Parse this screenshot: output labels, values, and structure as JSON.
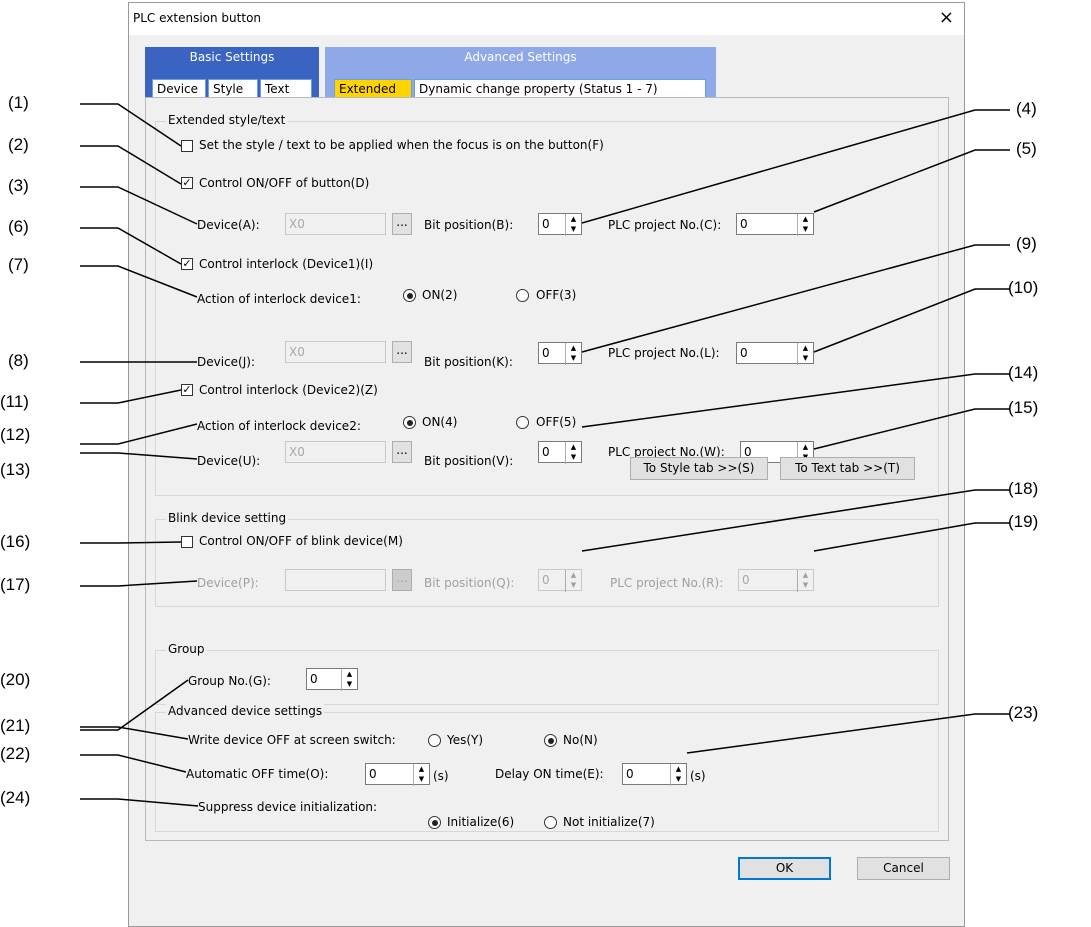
{
  "window": {
    "title": "PLC extension button",
    "close": "×"
  },
  "tabs": {
    "basic_group": "Basic Settings",
    "advanced_group": "Advanced Settings",
    "device": "Device",
    "style": "Style",
    "text": "Text",
    "extended": "Extended",
    "dynamic": "Dynamic change property (Status 1 - 7)"
  },
  "extended_group": {
    "title": "Extended style/text",
    "focus_cb": "Set the style / text to be applied when the focus is on the button(F)",
    "control_onoff_cb": "Control ON/OFF of button(D)",
    "device_a_label": "Device(A):",
    "device_a_value": "X0",
    "bit_b_label": "Bit position(B):",
    "bit_b_value": "0",
    "plc_c_label": "PLC project No.(C):",
    "plc_c_value": "0",
    "interlock1_cb": "Control interlock (Device1)(I)",
    "action1_label": "Action of interlock device1:",
    "on2": "ON(2)",
    "off3": "OFF(3)",
    "device_j_label": "Device(J):",
    "device_j_value": "X0",
    "bit_k_label": "Bit position(K):",
    "bit_k_value": "0",
    "plc_l_label": "PLC project No.(L):",
    "plc_l_value": "0",
    "interlock2_cb": "Control interlock (Device2)(Z)",
    "action2_label": "Action of interlock device2:",
    "on4": "ON(4)",
    "off5": "OFF(5)",
    "device_u_label": "Device(U):",
    "device_u_value": "X0",
    "bit_v_label": "Bit position(V):",
    "bit_v_value": "0",
    "plc_w_label": "PLC project No.(W):",
    "plc_w_value": "0",
    "to_style": "To Style tab >>(S)",
    "to_text": "To Text tab >>(T)"
  },
  "blink_group": {
    "title": "Blink device setting",
    "blink_cb": "Control ON/OFF of blink device(M)",
    "device_p_label": "Device(P):",
    "device_p_value": "",
    "bit_q_label": "Bit position(Q):",
    "bit_q_value": "0",
    "plc_r_label": "PLC project No.(R):",
    "plc_r_value": "0"
  },
  "group_group": {
    "title": "Group",
    "group_no_label": "Group No.(G):",
    "group_no_value": "0"
  },
  "advanced_group": {
    "title": "Advanced device settings",
    "write_off_label": "Write device OFF at screen switch:",
    "yes": "Yes(Y)",
    "no": "No(N)",
    "auto_off_label": "Automatic OFF time(O):",
    "auto_off_value": "0",
    "unit_s1": "(s)",
    "delay_on_label": "Delay ON time(E):",
    "delay_on_value": "0",
    "unit_s2": "(s)",
    "suppress_label": "Suppress device initialization:",
    "init": "Initialize(6)",
    "not_init": "Not initialize(7)"
  },
  "footer": {
    "ok": "OK",
    "cancel": "Cancel"
  },
  "callouts": [
    "(1)",
    "(2)",
    "(3)",
    "(6)",
    "(7)",
    "(8)",
    "(11)",
    "(12)",
    "(13)",
    "(16)",
    "(17)",
    "(20)",
    "(21)",
    "(22)",
    "(24)",
    "(4)",
    "(5)",
    "(9)",
    "(10)",
    "(14)",
    "(15)",
    "(18)",
    "(19)",
    "(23)"
  ]
}
